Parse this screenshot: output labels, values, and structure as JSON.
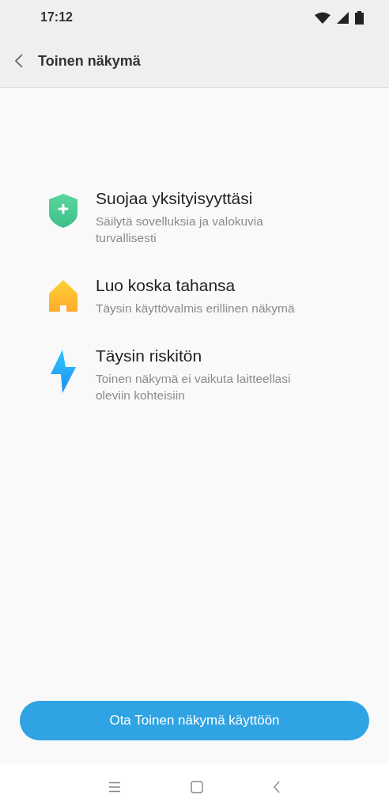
{
  "status_bar": {
    "time": "17:12"
  },
  "header": {
    "title": "Toinen näkymä"
  },
  "features": [
    {
      "kind": "shield",
      "title": "Suojaa yksityisyyttäsi",
      "subtitle": "Säilytä sovelluksia ja valokuvia turvallisesti"
    },
    {
      "kind": "house",
      "title": "Luo koska tahansa",
      "subtitle": "Täysin käyttövalmis erillinen näkymä"
    },
    {
      "kind": "bolt",
      "title": "Täysin riskitön",
      "subtitle": "Toinen näkymä ei vaikuta laitteellasi oleviin kohteisiin"
    }
  ],
  "button": {
    "label": "Ota Toinen näkymä käyttöön"
  }
}
